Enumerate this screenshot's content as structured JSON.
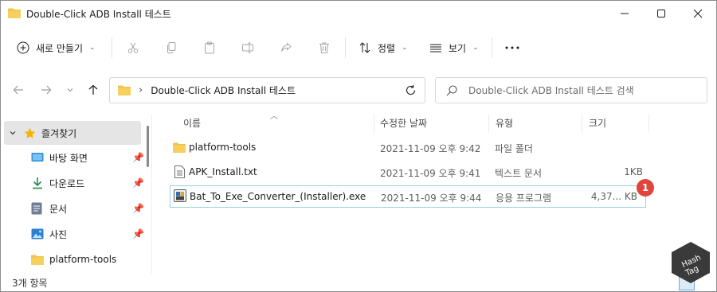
{
  "window": {
    "title": "Double-Click ADB Install 테스트",
    "controls": [
      "minimize",
      "maximize",
      "close"
    ]
  },
  "toolbar": {
    "new_label": "새로 만들기",
    "sort_label": "정렬",
    "view_label": "보기",
    "more_label": "···",
    "tools": [
      "cut-icon",
      "copy-icon",
      "paste-icon",
      "rename-icon",
      "share-icon",
      "delete-icon"
    ]
  },
  "address": {
    "path": "Double-Click ADB Install 테스트"
  },
  "search": {
    "placeholder": "Double-Click ADB Install 테스트 검색"
  },
  "sidebar": {
    "favorites_label": "즐겨찾기",
    "items": [
      {
        "label": "바탕 화면",
        "icon": "desktop-icon",
        "pinned": true
      },
      {
        "label": "다운로드",
        "icon": "download-icon",
        "pinned": true
      },
      {
        "label": "문서",
        "icon": "document-icon",
        "pinned": true
      },
      {
        "label": "사진",
        "icon": "pictures-icon",
        "pinned": true
      },
      {
        "label": "platform-tools",
        "icon": "folder-icon",
        "pinned": false
      }
    ]
  },
  "columns": {
    "name": "이름",
    "modified": "수정한 날짜",
    "type": "유형",
    "size": "크기"
  },
  "files": [
    {
      "name": "platform-tools",
      "modified": "2021-11-09 오후 9:42",
      "type": "파일 폴더",
      "size": "",
      "icon": "folder-icon",
      "selected": false
    },
    {
      "name": "APK_Install.txt",
      "modified": "2021-11-09 오후 9:41",
      "type": "텍스트 문서",
      "size": "1KB",
      "icon": "text-file-icon",
      "selected": false
    },
    {
      "name": "Bat_To_Exe_Converter_(Installer).exe",
      "modified": "2021-11-09 오후 9:44",
      "type": "응용 프로그램",
      "size": "4,37... KB",
      "icon": "exe-icon",
      "selected": true
    }
  ],
  "status": {
    "count": "3개 항목"
  },
  "overlay": {
    "badge_number": "1",
    "badge_color": "#e0443e",
    "watermark_line1": "Hash",
    "watermark_line2": "Tag"
  },
  "colors": {
    "accent": "#0067c0",
    "folder": "#f2c14e",
    "selection_border": "#99cfe8",
    "nav_selected": "#e5e5e5"
  }
}
